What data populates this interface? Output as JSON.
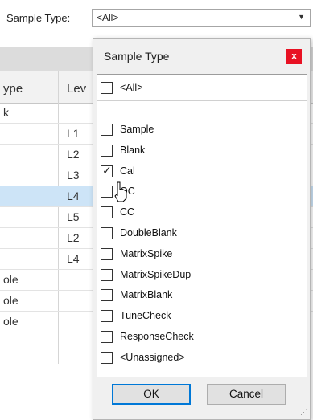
{
  "filter": {
    "label": "Sample Type:",
    "value": "<All>"
  },
  "grid": {
    "headers": {
      "col1": "ype",
      "col2": "Lev"
    },
    "rows": [
      {
        "c1": "k",
        "c2": ""
      },
      {
        "c1": "",
        "c2": "L1"
      },
      {
        "c1": "",
        "c2": "L2"
      },
      {
        "c1": "",
        "c2": "L3"
      },
      {
        "c1": "",
        "c2": "L4",
        "selected": true
      },
      {
        "c1": "",
        "c2": "L5"
      },
      {
        "c1": "",
        "c2": "L2"
      },
      {
        "c1": "",
        "c2": "L4"
      },
      {
        "c1": "ole",
        "c2": ""
      },
      {
        "c1": "ole",
        "c2": ""
      },
      {
        "c1": "ole",
        "c2": ""
      }
    ]
  },
  "popup": {
    "title": "Sample Type",
    "close_label": "x",
    "all_item": {
      "label": "<All>",
      "checked": false
    },
    "items": [
      {
        "label": "Sample",
        "checked": false
      },
      {
        "label": "Blank",
        "checked": false
      },
      {
        "label": "Cal",
        "checked": true
      },
      {
        "label": "QC",
        "checked": false
      },
      {
        "label": "CC",
        "checked": false
      },
      {
        "label": "DoubleBlank",
        "checked": false
      },
      {
        "label": "MatrixSpike",
        "checked": false
      },
      {
        "label": "MatrixSpikeDup",
        "checked": false
      },
      {
        "label": "MatrixBlank",
        "checked": false
      },
      {
        "label": "TuneCheck",
        "checked": false
      },
      {
        "label": "ResponseCheck",
        "checked": false
      },
      {
        "label": "<Unassigned>",
        "checked": false
      }
    ],
    "ok_label": "OK",
    "cancel_label": "Cancel"
  }
}
